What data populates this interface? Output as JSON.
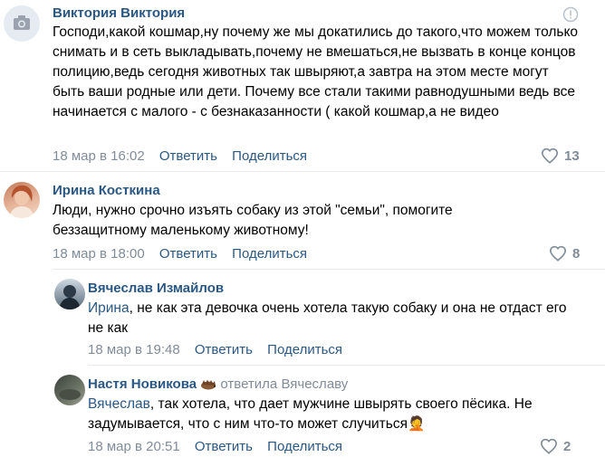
{
  "comments": [
    {
      "author": "Виктория Виктория",
      "text": "Господи,какой кошмар,ну почему же мы докатились до такого,что можем только снимать и в сеть выкладывать,почему не вмешаться,не вызвать в конце концов полицию,ведь сегодня животных так швыряют,а завтра на этом месте могут быть ваши родные или дети. Почему все стали такими равнодушными ведь все начинается с малого - с безнаказанности ( какой кошмар,а не видео",
      "date": "18 мар в 16:02",
      "reply": "Ответить",
      "share": "Поделиться",
      "likes": "13"
    },
    {
      "author": "Ирина Косткина",
      "text": "Люди, нужно срочно изъять собаку из этой \"семьи\", помогите беззащитному маленькому животному!",
      "date": "18 мар в 18:00",
      "reply": "Ответить",
      "share": "Поделиться",
      "likes": "8"
    },
    {
      "author": "Вячеслав Измайлов",
      "addressee": "Ирина",
      "text": ", не как эта девочка очень хотела такую собаку и она не отдаст его не как",
      "date": "18 мар в 19:48",
      "reply": "Ответить",
      "share": "Поделиться"
    },
    {
      "author": "Настя Новикова",
      "replied_to": "ответила Вячеславу",
      "addressee": "Вячеслав",
      "text": ", так хотела, что дает мужчине швырять своего пёсика. Не задумывается, что с ним что-то может случиться🤦",
      "date": "18 мар в 20:51",
      "reply": "Ответить",
      "share": "Поделиться",
      "likes": "2"
    }
  ],
  "icons": {
    "camera": "camera-icon",
    "heart": "heart-icon",
    "report": "report-icon"
  },
  "colors": {
    "link": "#2a5885",
    "meta": "#818c99",
    "divider": "#e7e8ec"
  }
}
